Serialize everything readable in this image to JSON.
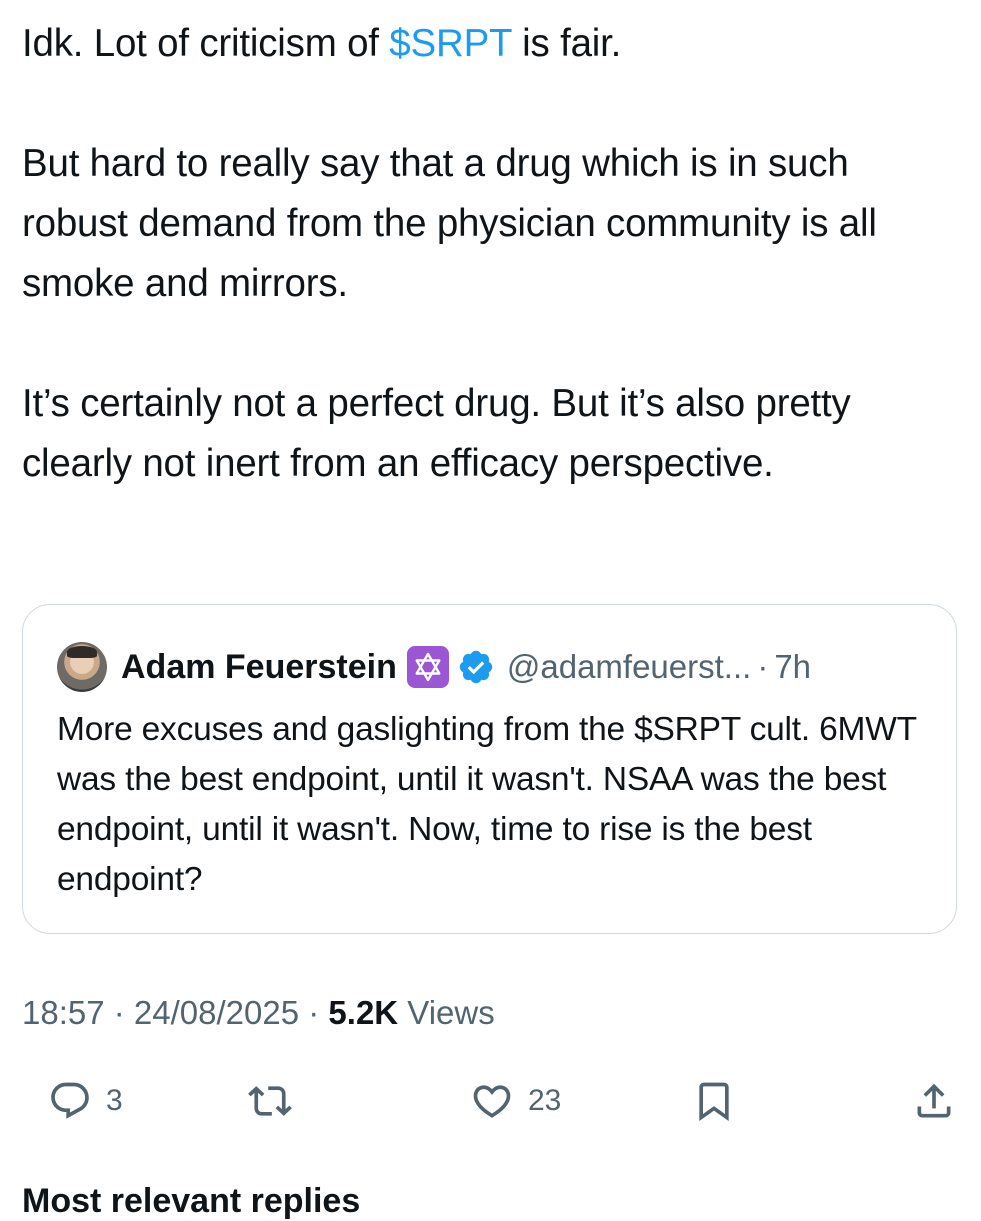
{
  "tweet": {
    "p1_before": "Idk. Lot of criticism of ",
    "p1_cashtag": "$SRPT",
    "p1_after": " is fair.",
    "p2": "But hard to really say that a drug which is in such robust demand from the physician community is all smoke and mirrors.",
    "p3": "It’s certainly not a perfect drug. But it’s also pretty clearly not inert from an efficacy perspective."
  },
  "quote": {
    "name": "Adam Feuerstein",
    "badge_icon": "star-of-david-icon",
    "verified_icon": "verified-badge-icon",
    "handle": "@adamfeuerst...",
    "separator": "·",
    "time": "7h",
    "body": "More excuses and gaslighting from the $SRPT cult. 6MWT was the best endpoint, until it wasn't. NSAA was the best endpoint, until it wasn't. Now, time to rise is the best endpoint?"
  },
  "meta": {
    "time": "18:57",
    "sep1": " · ",
    "date": "24/08/2025",
    "sep2": " · ",
    "views_count": "5.2K",
    "views_label": " Views"
  },
  "actions": {
    "replies": "3",
    "likes": "23"
  },
  "replies_section": {
    "heading": "Most relevant replies"
  },
  "colors": {
    "cashtag": "#1d9bf0",
    "secondary_text": "#536471",
    "card_border": "#cfd9de",
    "star_badge": "#9b57d3",
    "verified": "#1d9bf0"
  }
}
